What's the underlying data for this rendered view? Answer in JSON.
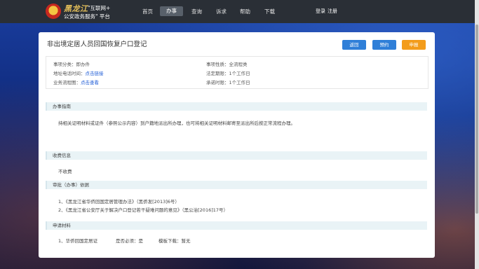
{
  "header": {
    "logo_name": "黑龙江",
    "logo_sub1": "\"互联网+",
    "logo_sub2": "公安政务服务\" 平台",
    "nav": [
      "首页",
      "办事",
      "查询",
      "诉求",
      "帮助",
      "下载"
    ],
    "active_nav": "办事",
    "login": "登录",
    "register": "注册"
  },
  "page": {
    "title": "非出境定居人员回国恢复户口登记",
    "buttons": {
      "back": "返回",
      "reserve": "预约",
      "apply": "申报"
    }
  },
  "info": {
    "category_label": "事项分类：",
    "category_value": "即办件",
    "nature_label": "事项性质：",
    "nature_value": "全流程类",
    "address_label": "地址电话时间：",
    "address_link": "点击链接",
    "legal_label": "法定期限：",
    "legal_value": "1个工作日",
    "flow_label": "业务流程图：",
    "flow_link": "点击查看",
    "promise_label": "承诺时限：",
    "promise_value": "1个工作日"
  },
  "sections": {
    "guide_title": "办事指南",
    "guide_text": "持相关证明材料或证件（参照公示内容）到户籍地派出所办理，也可将相关证明材料邮寄至派出所后按正常流程办理。",
    "fee_title": "收费信息",
    "fee_text": "不收费",
    "basis_title": "审批（办事）依据",
    "basis_items": [
      "1、《黑龙江省华侨回国定居管理办法》（黑侨发[2013]6号）",
      "2、《黑龙江省公安厅关于解决户口登记若干疑难问题的意见》（黑公治[2016]17号）"
    ],
    "material_title": "申请材料",
    "material_item": "1、华侨回国定居证",
    "material_required": "是否必须：是",
    "material_template": "模板下载：暂无"
  },
  "colors": {
    "header_bg": "#2a2f36",
    "button_blue": "#2f7fd8",
    "button_orange": "#f39c1b",
    "link": "#1d5bd6",
    "section_bg": "#e9f3f6"
  }
}
